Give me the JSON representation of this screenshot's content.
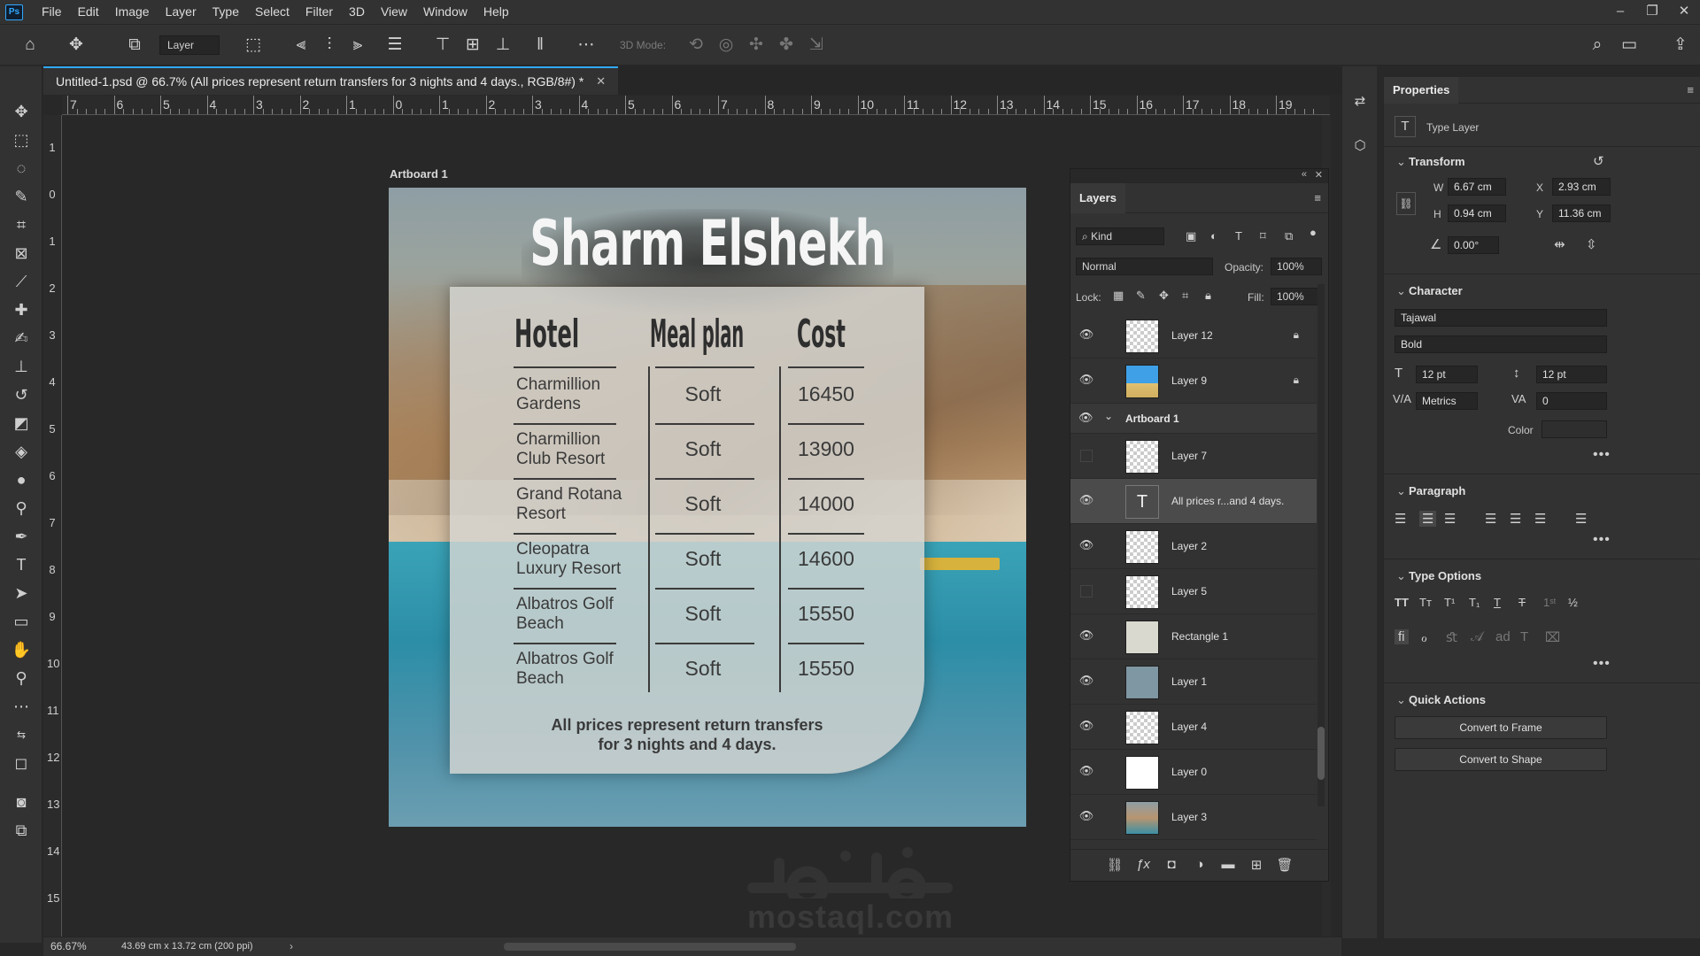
{
  "app": {
    "menu": [
      "File",
      "Edit",
      "Image",
      "Layer",
      "Type",
      "Select",
      "Filter",
      "3D",
      "View",
      "Window",
      "Help"
    ],
    "logo": "Ps",
    "window_controls": [
      "–",
      "❐",
      "✕"
    ]
  },
  "options_bar": {
    "layer_select": "Layer",
    "mode3d_label": "3D Mode:"
  },
  "document": {
    "tab_title": "Untitled-1.psd @ 66.7% (All prices represent return transfers for 3 nights and 4 days., RGB/8#) *",
    "artboard_label": "Artboard 1"
  },
  "ruler": {
    "top_labels": [
      "7",
      "6",
      "5",
      "4",
      "3",
      "2",
      "1",
      "0",
      "1",
      "2",
      "3",
      "4",
      "5",
      "6",
      "7",
      "8",
      "9",
      "10",
      "11",
      "12",
      "13",
      "14",
      "15",
      "16",
      "17",
      "18",
      "19"
    ],
    "left_labels": [
      "1",
      "0",
      "1",
      "2",
      "3",
      "4",
      "5",
      "6",
      "7",
      "8",
      "9",
      "10",
      "11",
      "12",
      "13",
      "14",
      "15"
    ]
  },
  "poster": {
    "title": "Sharm Elshekh",
    "headers": {
      "hotel": "Hotel",
      "meal": "Meal plan",
      "cost": "Cost"
    },
    "rows": [
      {
        "hotel": "Charmillion Gardens",
        "meal": "Soft",
        "cost": "16450"
      },
      {
        "hotel": "Charmillion Club Resort",
        "meal": "Soft",
        "cost": "13900"
      },
      {
        "hotel": "Grand Rotana Resort",
        "meal": "Soft",
        "cost": "14000"
      },
      {
        "hotel": "Cleopatra Luxury Resort",
        "meal": "Soft",
        "cost": "14600"
      },
      {
        "hotel": "Albatros Golf Beach",
        "meal": "Soft",
        "cost": "15550"
      },
      {
        "hotel": "Albatros Golf Beach",
        "meal": "Soft",
        "cost": "15550"
      }
    ],
    "footnote_line1": "All prices represent return transfers",
    "footnote_line2": "for 3 nights and 4 days."
  },
  "watermark": {
    "text": "mostaql.com"
  },
  "layers_panel": {
    "tab": "Layers",
    "filter_kind": "Kind",
    "blend_mode": "Normal",
    "opacity_label": "Opacity:",
    "opacity_value": "100%",
    "lock_label": "Lock:",
    "fill_label": "Fill:",
    "fill_value": "100%",
    "layers": [
      {
        "name": "Layer 12",
        "visible": true,
        "locked": true,
        "thumb": "transparent"
      },
      {
        "name": "Layer 9",
        "visible": true,
        "locked": true,
        "thumb": "blue-image"
      },
      {
        "name": "Artboard 1",
        "visible": true,
        "group": true
      },
      {
        "name": "Layer 7",
        "visible": false,
        "thumb": "transparent"
      },
      {
        "name": "All prices r...and 4 days.",
        "visible": true,
        "selected": true,
        "thumb": "type"
      },
      {
        "name": "Layer 2",
        "visible": true,
        "thumb": "transparent"
      },
      {
        "name": "Layer 5",
        "visible": false,
        "thumb": "transparent"
      },
      {
        "name": "Rectangle 1",
        "visible": true,
        "thumb": "shape"
      },
      {
        "name": "Layer 1",
        "visible": true,
        "thumb": "grey"
      },
      {
        "name": "Layer 4",
        "visible": true,
        "thumb": "transparent"
      },
      {
        "name": "Layer 0",
        "visible": true,
        "thumb": "white"
      },
      {
        "name": "Layer 3",
        "visible": true,
        "thumb": "photo"
      }
    ]
  },
  "properties": {
    "tab": "Properties",
    "layer_type": "Type Layer",
    "transform": {
      "title": "Transform",
      "w_label": "W",
      "w": "6.67 cm",
      "h_label": "H",
      "h": "0.94 cm",
      "x_label": "X",
      "x": "2.93 cm",
      "y_label": "Y",
      "y": "11.36 cm",
      "angle": "0.00°"
    },
    "character": {
      "title": "Character",
      "font": "Tajawal",
      "style": "Bold",
      "size": "12 pt",
      "leading": "12 pt",
      "kerning": "Metrics",
      "tracking": "0",
      "color_label": "Color"
    },
    "paragraph": {
      "title": "Paragraph"
    },
    "type_options": {
      "title": "Type Options"
    },
    "quick_actions": {
      "title": "Quick Actions",
      "btn1": "Convert to Frame",
      "btn2": "Convert to Shape"
    }
  },
  "status": {
    "zoom": "66.67%",
    "doc_size": "43.69 cm x 13.72 cm (200 ppi)"
  }
}
